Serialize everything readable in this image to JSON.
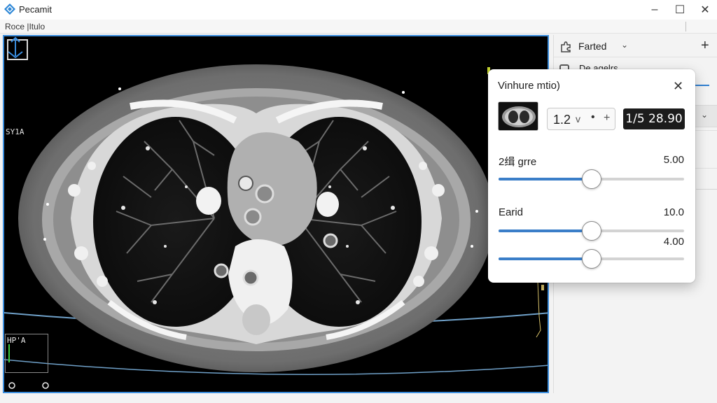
{
  "window": {
    "title": "Pecamit",
    "minimize_glyph": "–",
    "maximize_glyph": "☐",
    "close_glyph": "✕"
  },
  "menu": {
    "item": "Roce |Itulo"
  },
  "viewport": {
    "top_left_label": "SY1A",
    "mini_label": "HP'A",
    "bottom_icons": [
      "circle-icon",
      "circle-icon"
    ],
    "orientation_icon": "arrows-icon"
  },
  "right_panel": {
    "header_label": "Farted",
    "header_chevron": "⌄",
    "header_plus": "+",
    "row_label": "De agelrs",
    "item2_chevron": "⌄",
    "accent": "#2f7fd1"
  },
  "popup": {
    "title": "Vinhure mtio)",
    "close_glyph": "✕",
    "spin_value": "1.2",
    "spin_down": "v",
    "spin_dot": "•",
    "spin_plus": "+",
    "dark_readout": "1/5 28.90",
    "slider1": {
      "label": "2缉 grre",
      "value_text": "5.00",
      "level_percent": 50
    },
    "slider2": {
      "label": "Earid",
      "value_text": "10.0",
      "level_percent": 50
    },
    "slider3": {
      "value_text": "4.00",
      "level_percent": 50
    }
  },
  "colors": {
    "accent": "#3a7ec8",
    "viewport_border": "#3b8ddc"
  }
}
